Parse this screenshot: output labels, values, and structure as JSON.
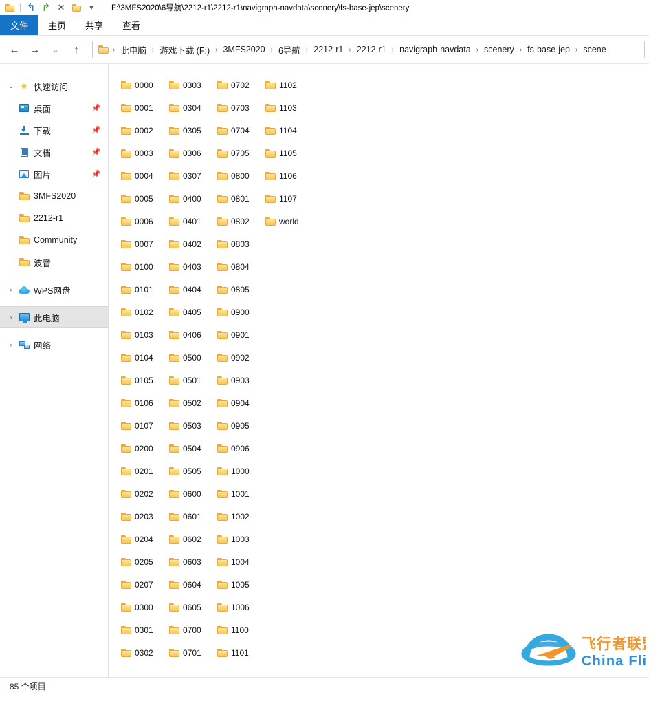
{
  "titlebar": {
    "path": "F:\\3MFS2020\\6导航\\2212-r1\\2212-r1\\navigraph-navdata\\scenery\\fs-base-jep\\scenery",
    "icons": [
      {
        "name": "folder-icon",
        "glyph": "folder"
      },
      {
        "name": "undo-icon",
        "glyph": "↶"
      },
      {
        "name": "redo-icon",
        "glyph": "↷"
      },
      {
        "name": "close-icon",
        "glyph": "✕"
      },
      {
        "name": "new-folder-icon",
        "glyph": "folder"
      },
      {
        "name": "quick-access-toolbar-chevron-icon",
        "glyph": "▾"
      }
    ]
  },
  "ribbon": {
    "tabs": [
      {
        "label": "文件",
        "name": "tab-file",
        "active": true
      },
      {
        "label": "主页",
        "name": "tab-home",
        "active": false
      },
      {
        "label": "共享",
        "name": "tab-share",
        "active": false
      },
      {
        "label": "查看",
        "name": "tab-view",
        "active": false
      }
    ]
  },
  "navbar": {
    "back": "←",
    "forward": "→",
    "recent": "⌄",
    "up": "↑",
    "breadcrumbs": [
      "此电脑",
      "游戏下载 (F:)",
      "3MFS2020",
      "6导航",
      "2212-r1",
      "2212-r1",
      "navigraph-navdata",
      "scenery",
      "fs-base-jep",
      "scene"
    ],
    "separator": "›"
  },
  "sidebar": {
    "items": [
      {
        "label": "快速访问",
        "icon": "star-icon",
        "chevron": "⌄",
        "indent": false,
        "pinned": false,
        "selected": false,
        "name": "sidebar-item-quick-access"
      },
      {
        "label": "桌面",
        "icon": "desktop-icon",
        "chevron": "",
        "indent": true,
        "pinned": true,
        "selected": false,
        "name": "sidebar-item-desktop"
      },
      {
        "label": "下载",
        "icon": "download-icon",
        "chevron": "",
        "indent": true,
        "pinned": true,
        "selected": false,
        "name": "sidebar-item-downloads"
      },
      {
        "label": "文档",
        "icon": "document-icon",
        "chevron": "",
        "indent": true,
        "pinned": true,
        "selected": false,
        "name": "sidebar-item-documents"
      },
      {
        "label": "图片",
        "icon": "pictures-icon",
        "chevron": "",
        "indent": true,
        "pinned": true,
        "selected": false,
        "name": "sidebar-item-pictures"
      },
      {
        "label": "3MFS2020",
        "icon": "folder-icon",
        "chevron": "",
        "indent": true,
        "pinned": false,
        "selected": false,
        "name": "sidebar-item-3mfs2020"
      },
      {
        "label": "2212-r1",
        "icon": "folder-icon",
        "chevron": "",
        "indent": true,
        "pinned": false,
        "selected": false,
        "name": "sidebar-item-2212-r1"
      },
      {
        "label": "Community",
        "icon": "folder-icon",
        "chevron": "",
        "indent": true,
        "pinned": false,
        "selected": false,
        "name": "sidebar-item-community"
      },
      {
        "label": "波音",
        "icon": "folder-icon",
        "chevron": "",
        "indent": true,
        "pinned": false,
        "selected": false,
        "name": "sidebar-item-boeing"
      },
      {
        "label": "WPS网盘",
        "icon": "cloud-icon",
        "chevron": "›",
        "indent": false,
        "pinned": false,
        "selected": false,
        "name": "sidebar-item-wps-cloud"
      },
      {
        "label": "此电脑",
        "icon": "this-pc-icon",
        "chevron": "›",
        "indent": false,
        "pinned": false,
        "selected": true,
        "name": "sidebar-item-this-pc"
      },
      {
        "label": "网络",
        "icon": "network-icon",
        "chevron": "›",
        "indent": false,
        "pinned": false,
        "selected": false,
        "name": "sidebar-item-network"
      }
    ],
    "pin_glyph": "📌"
  },
  "content": {
    "folders": [
      "0000",
      "0001",
      "0002",
      "0003",
      "0004",
      "0005",
      "0006",
      "0007",
      "0100",
      "0101",
      "0102",
      "0103",
      "0104",
      "0105",
      "0106",
      "0107",
      "0200",
      "0201",
      "0202",
      "0203",
      "0204",
      "0205",
      "0207",
      "0300",
      "0301",
      "0302",
      "0303",
      "0304",
      "0305",
      "0306",
      "0307",
      "0400",
      "0401",
      "0402",
      "0403",
      "0404",
      "0405",
      "0406",
      "0500",
      "0501",
      "0502",
      "0503",
      "0504",
      "0505",
      "0600",
      "0601",
      "0602",
      "0603",
      "0604",
      "0605",
      "0700",
      "0701",
      "0702",
      "0703",
      "0704",
      "0705",
      "0800",
      "0801",
      "0802",
      "0803",
      "0804",
      "0805",
      "0900",
      "0901",
      "0902",
      "0903",
      "0904",
      "0905",
      "0906",
      "1000",
      "1001",
      "1002",
      "1003",
      "1004",
      "1005",
      "1006",
      "1100",
      "1101",
      "1102",
      "1103",
      "1104",
      "1105",
      "1106",
      "1107",
      "world"
    ]
  },
  "watermark": {
    "title_cn": "飞行者联盟",
    "title_en": "China Flier",
    "color_blue": "#35a8e0",
    "color_orange": "#f0962a"
  },
  "statusbar": {
    "item_count": "85 个项目"
  }
}
